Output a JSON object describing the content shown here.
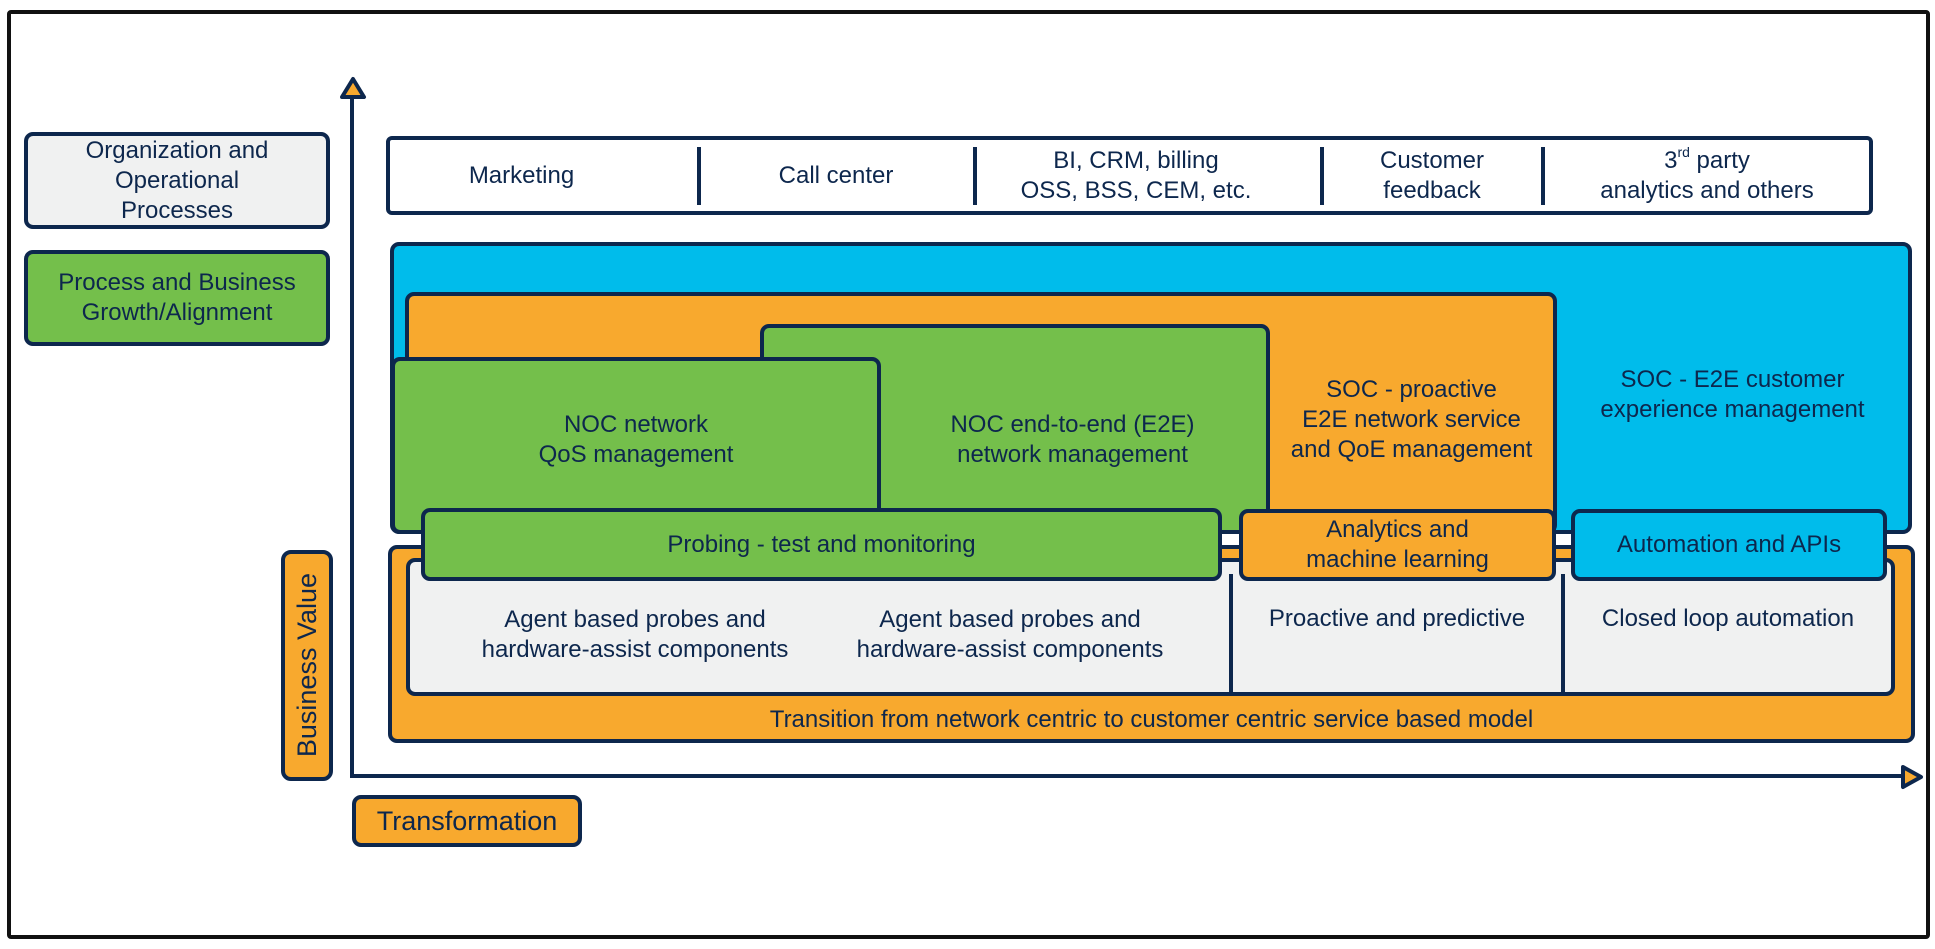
{
  "axes": {
    "y_label": "Business Value",
    "x_label": "Transformation"
  },
  "legend": [
    {
      "label": "Organization and\nOperational\nProcesses",
      "color": "#f0f1f1"
    },
    {
      "label": "Process and Business\nGrowth/Alignment",
      "color": "#74bf4b"
    }
  ],
  "sources": [
    {
      "label": "Marketing"
    },
    {
      "label": "Call center"
    },
    {
      "label": "BI, CRM, billing\nOSS, BSS, CEM, etc."
    },
    {
      "label": "Customer\nfeedback"
    },
    {
      "label_prefix": "3",
      "label_sup": "rd",
      "label_rest": " party",
      "label_line2": "analytics and others"
    }
  ],
  "layers": {
    "noc_network": "NOC network\nQoS management",
    "noc_e2e": "NOC end-to-end (E2E)\nnetwork management",
    "soc_proactive": "SOC - proactive\nE2E network service\nand QoE management",
    "soc_customer": "SOC - E2E customer\nexperience management"
  },
  "capabilities": {
    "probing": "Probing - test and monitoring",
    "analytics": "Analytics and\nmachine learning",
    "automation": "Automation and APIs"
  },
  "foundation": {
    "agent_probes_1": "Agent based probes and\nhardware-assist components",
    "agent_probes_2": "Agent based probes and\nhardware-assist components",
    "proactive": "Proactive and predictive",
    "closed_loop": "Closed loop automation"
  },
  "transition": "Transition from network centric to customer centric service based model",
  "colors": {
    "navy": "#0d274d",
    "green": "#74bf4b",
    "orange": "#f8a92e",
    "blue": "#00bceb",
    "gray": "#f0f1f1"
  }
}
